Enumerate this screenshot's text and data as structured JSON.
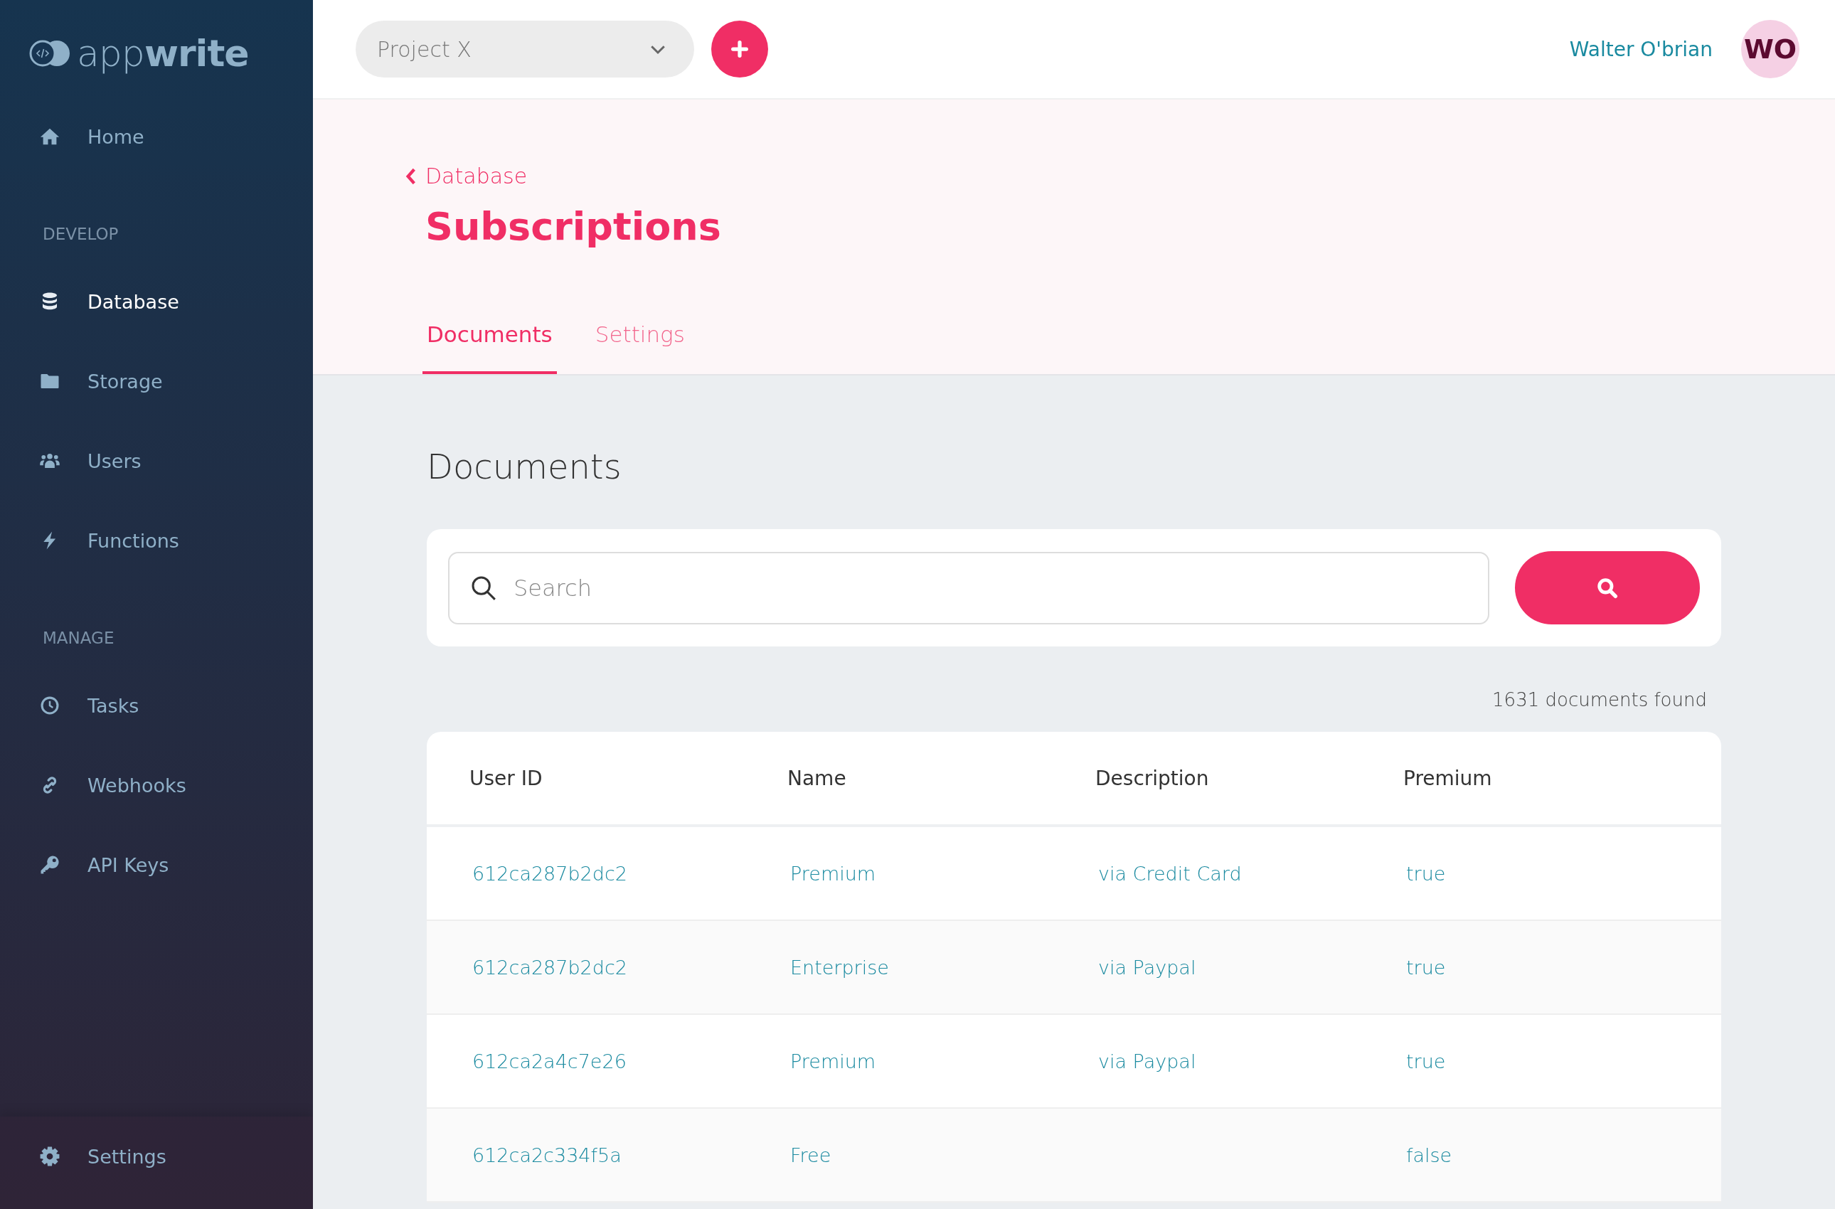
{
  "sidebar": {
    "logo": "app**write**",
    "home": {
      "label": "Home",
      "selected": false
    },
    "sections": [
      {
        "heading": "DEVELOP",
        "items": [
          {
            "label": "Database",
            "selected": true
          },
          {
            "label": "Storage",
            "selected": false
          },
          {
            "label": "Users",
            "selected": false
          },
          {
            "label": "Functions",
            "selected": false
          }
        ]
      },
      {
        "heading": "MANAGE",
        "items": [
          {
            "label": "Tasks",
            "selected": false
          },
          {
            "label": "Webhooks",
            "selected": false
          },
          {
            "label": "API Keys",
            "selected": false
          }
        ]
      }
    ],
    "footer": {
      "label": "Settings",
      "selected": false
    }
  },
  "topbar": {
    "project": "Project X",
    "user_name": "Walter O'brian",
    "avatar_initials": "WO"
  },
  "header": {
    "breadcrumb": "Database",
    "title": "Subscriptions",
    "tabs": [
      {
        "label": "Documents",
        "selected": true
      },
      {
        "label": "Settings",
        "selected": false
      }
    ]
  },
  "content": {
    "heading": "Documents",
    "search": {
      "placeholder": "Search"
    },
    "count": "1631 documents found",
    "table": {
      "columns": [
        "User ID",
        "Name",
        "Description",
        "Premium"
      ],
      "rows": [
        {
          "user_id": "612ca287b2dc2",
          "name": "Premium",
          "description": "via Credit Card",
          "premium": "true"
        },
        {
          "user_id": "612ca287b2dc2",
          "name": "Enterprise",
          "description": "via Paypal",
          "premium": "true"
        },
        {
          "user_id": "612ca2a4c7e26",
          "name": "Premium",
          "description": "via Paypal",
          "premium": "true"
        },
        {
          "user_id": "612ca2c334f5a",
          "name": "Free",
          "premium": "false"
        }
      ]
    }
  }
}
